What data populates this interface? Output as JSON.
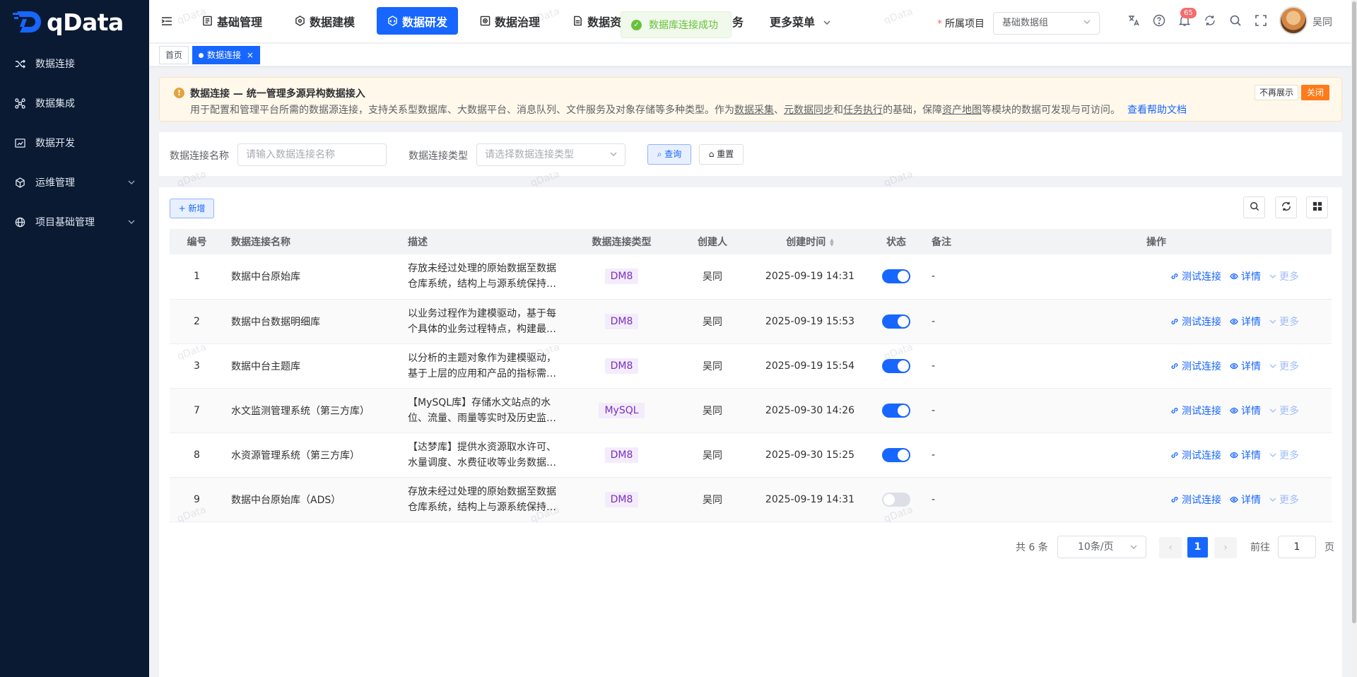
{
  "app": {
    "logo_text": "qData"
  },
  "sidebar": {
    "items": [
      {
        "label": "数据连接",
        "icon": "shuffle-icon",
        "active": true
      },
      {
        "label": "数据集成",
        "icon": "nodes-icon"
      },
      {
        "label": "数据开发",
        "icon": "chart-box-icon"
      },
      {
        "label": "运维管理",
        "icon": "cube-icon",
        "expandable": true
      },
      {
        "label": "项目基础管理",
        "icon": "globe-icon",
        "expandable": true
      }
    ]
  },
  "header": {
    "nav": [
      {
        "label": "基础管理",
        "icon": "document-icon"
      },
      {
        "label": "数据建模",
        "icon": "gear-cube-icon"
      },
      {
        "label": "数据研发",
        "icon": "code-cube-icon",
        "active": true
      },
      {
        "label": "数据治理",
        "icon": "shield-doc-icon"
      },
      {
        "label": "数据资",
        "icon": "file-icon"
      }
    ],
    "nav_partial_tail": "务",
    "more_menu": "更多菜单",
    "toast": "数据库连接成功",
    "project_label": "所属项目",
    "project_value": "基础数据组",
    "notification_count": "65",
    "user_name": "吴同"
  },
  "tags": {
    "home": "首页",
    "current": "数据连接"
  },
  "notice": {
    "title": "数据连接 — 统一管理多源异构数据接入",
    "desc_part1": "用于配置和管理平台所需的数据源连接，支持关系型数据库、大数据平台、消息队列、文件服务及对象存储等多种类型。作为",
    "link1": "数据采集",
    "sep1": "、",
    "link2": "元数据同步",
    "sep2": "和",
    "link3": "任务执行",
    "desc_part2": "的基础，保障",
    "link4": "资产地图",
    "desc_part3": "等模块的数据可发现与可访问。",
    "help": "查看帮助文档",
    "no_show": "不再展示",
    "close": "关闭"
  },
  "search": {
    "name_label": "数据连接名称",
    "name_placeholder": "请输入数据连接名称",
    "type_label": "数据连接类型",
    "type_placeholder": "请选择数据连接类型",
    "query": "查询",
    "reset": "重置"
  },
  "toolbar": {
    "add": "+ 新增"
  },
  "table": {
    "headers": [
      "编号",
      "数据连接名称",
      "描述",
      "数据连接类型",
      "创建人",
      "创建时间",
      "状态",
      "备注",
      "操作"
    ],
    "rows": [
      {
        "id": "1",
        "name": "数据中台原始库",
        "desc": "存放未经过处理的原始数据至数据仓库系统，结构上与源系统保持一致",
        "type": "DM8",
        "creator": "吴同",
        "time": "2025-09-19 14:31",
        "enabled": true,
        "remark": "-"
      },
      {
        "id": "2",
        "name": "数据中台数据明细库",
        "desc": "以业务过程作为建模驱动，基于每个具体的业务过程特点，构建最细粒度的明细层事实表",
        "type": "DM8",
        "creator": "吴同",
        "time": "2025-09-19 15:53",
        "enabled": true,
        "remark": "-"
      },
      {
        "id": "3",
        "name": "数据中台主题库",
        "desc": "以分析的主题对象作为建模驱动，基于上层的应用和产品的指标需求构建",
        "type": "DM8",
        "creator": "吴同",
        "time": "2025-09-19 15:54",
        "enabled": true,
        "remark": "-"
      },
      {
        "id": "7",
        "name": "水文监测管理系统（第三方库）",
        "desc": "【MySQL库】存储水文站点的水位、流量、雨量等实时及历史监测数据",
        "type": "MySQL",
        "creator": "吴同",
        "time": "2025-09-30 14:26",
        "enabled": true,
        "remark": "-"
      },
      {
        "id": "8",
        "name": "水资源管理系统（第三方库）",
        "desc": "【达梦库】提供水资源取水许可、水量调度、水费征收等业务数据支撑",
        "type": "DM8",
        "creator": "吴同",
        "time": "2025-09-30 15:25",
        "enabled": true,
        "remark": "-"
      },
      {
        "id": "9",
        "name": "数据中台原始库（ADS）",
        "desc": "存放未经过处理的原始数据至数据仓库系统，结构上与源系统保持一致",
        "type": "DM8",
        "creator": "吴同",
        "time": "2025-09-19 14:31",
        "enabled": false,
        "remark": "-"
      }
    ],
    "ops": {
      "test": "测试连接",
      "detail": "详情",
      "more": "更多"
    }
  },
  "pagination": {
    "total": "共 6 条",
    "page_size": "10条/页",
    "current": "1",
    "goto": "前往",
    "goto_value": "1",
    "page": "页"
  },
  "watermark": "qData",
  "colors": {
    "primary": "#1766ff",
    "sidebar": "#0a1a33",
    "success": "#67c23a",
    "warning": "#e6a23c",
    "close": "#ff7a1a"
  }
}
